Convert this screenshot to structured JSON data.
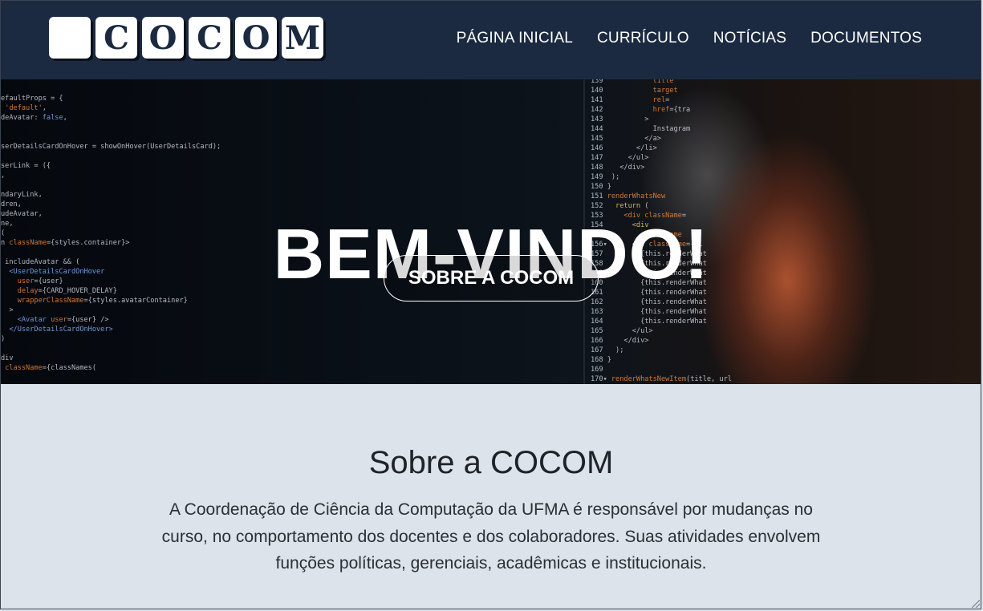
{
  "brand": {
    "logo_letters": [
      "",
      "C",
      "O",
      "C",
      "O",
      "M"
    ]
  },
  "nav": {
    "items": [
      {
        "label": "PÁGINA INICIAL"
      },
      {
        "label": "CURRÍCULO"
      },
      {
        "label": "NOTÍCIAS"
      },
      {
        "label": "DOCUMENTOS"
      }
    ]
  },
  "hero": {
    "title": "BEM-VINDO!",
    "button_label": "SOBRE A COCOM"
  },
  "about": {
    "title": "Sobre a COCOM",
    "text": "A Coordenação de Ciência da Computação da UFMA é responsável por mudanças no curso, no comportamento dos docentes e dos colaboradores. Suas atividades envolvem funções políticas, gerenciais, acadêmicas e institucionais."
  },
  "colors": {
    "navbar_bg": "#1b2a41",
    "about_bg": "#dde3ea",
    "text_dark": "#1f2329"
  }
}
